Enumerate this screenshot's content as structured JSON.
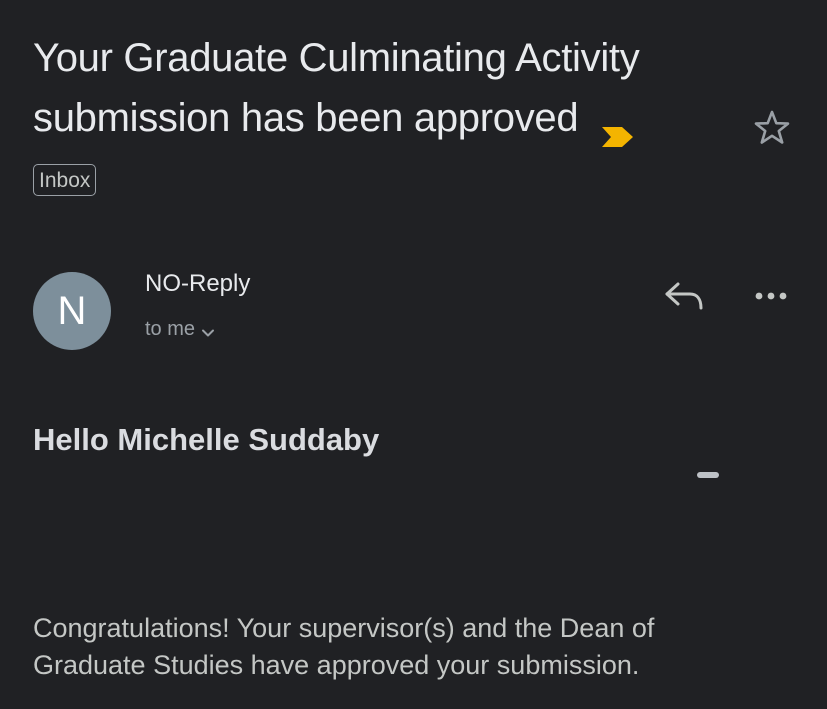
{
  "email": {
    "subject_line1": "Your Graduate Culminating Activity",
    "subject_line2": "submission has been approved",
    "label": "Inbox",
    "sender": {
      "name": "NO-Reply",
      "avatar_initial": "N",
      "recipient": "to me"
    },
    "greeting": "Hello Michelle Suddaby",
    "body_line1": "Congratulations! Your supervisor(s) and the Dean of",
    "body_line2": "Graduate Studies have approved your submission."
  },
  "icons": {
    "importance": "importance-marker-icon",
    "star": "star-icon",
    "reply": "reply-icon",
    "more": "more-options-icon",
    "recipient_chevron": "chevron-down-icon"
  },
  "colors": {
    "background": "#202124",
    "importance_marker": "#f4b400",
    "avatar": "#7d8f9b"
  }
}
